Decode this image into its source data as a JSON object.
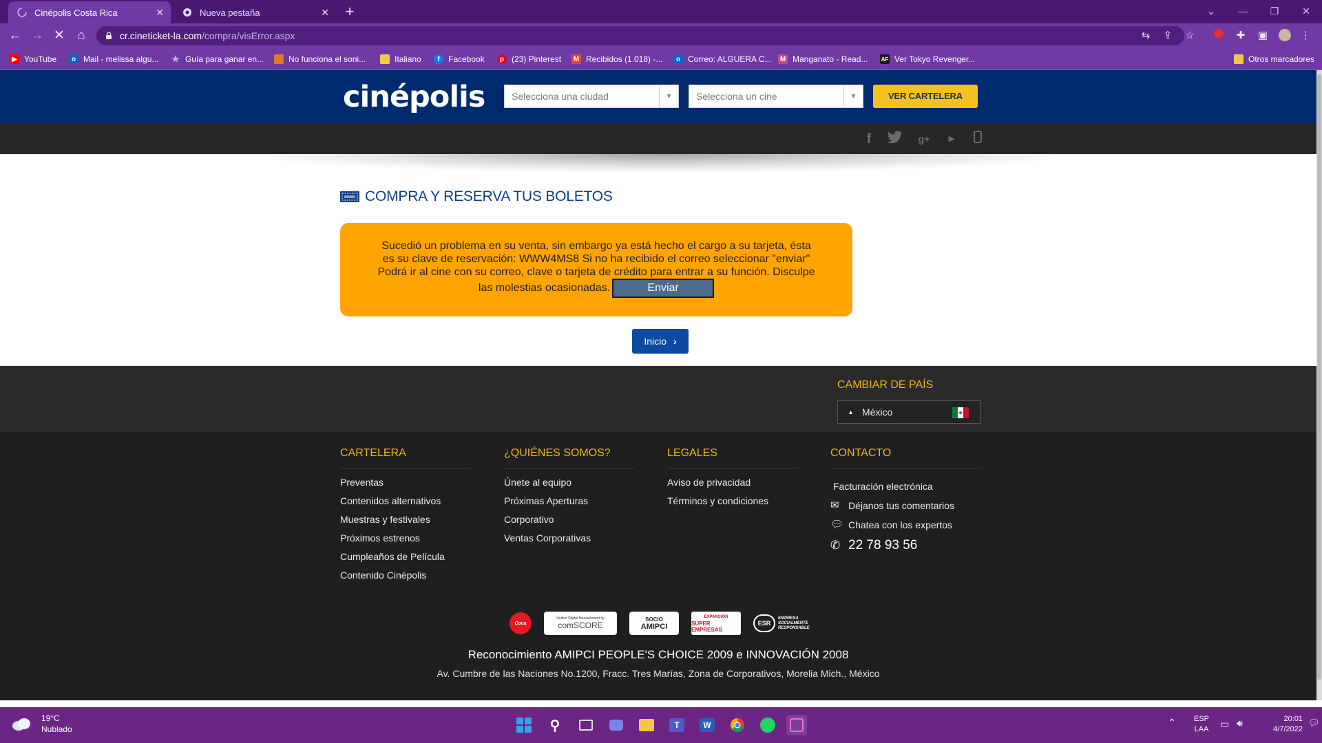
{
  "browser": {
    "tabs": [
      {
        "title": "Cinépolis Costa Rica",
        "active": true
      },
      {
        "title": "Nueva pestaña",
        "active": false
      }
    ],
    "url_host": "cr.cineticket-la.com",
    "url_path": "/compra/visError.aspx",
    "bookmarks": [
      {
        "label": "YouTube",
        "icon": "youtube-icon",
        "color": "#ff0000"
      },
      {
        "label": "Mail - melissa algu...",
        "icon": "outlook-icon",
        "color": "#0a64c8"
      },
      {
        "label": "Guía para ganar en...",
        "icon": "star-icon",
        "color": "#8fa0c8"
      },
      {
        "label": "No funciona el soni...",
        "icon": "page-icon",
        "color": "#e07a2a"
      },
      {
        "label": "Italiano",
        "icon": "folder-icon",
        "color": "#f2c94c"
      },
      {
        "label": "Facebook",
        "icon": "facebook-icon",
        "color": "#1877f2"
      },
      {
        "label": "(23) Pinterest",
        "icon": "pinterest-icon",
        "color": "#e60023"
      },
      {
        "label": "Recibidos (1.018) -...",
        "icon": "gmail-icon",
        "color": "#ea4335"
      },
      {
        "label": "Correo: ALGUERA C...",
        "icon": "outlook-icon",
        "color": "#0a64c8"
      },
      {
        "label": "Manganato - Read...",
        "icon": "manga-icon",
        "color": "#c24a8a"
      },
      {
        "label": "Ver Tokyo Revenger...",
        "icon": "af-icon",
        "color": "#1a1a1a"
      }
    ],
    "other_bookmarks": "Otros marcadores"
  },
  "header": {
    "logo": "cinépolis",
    "city_placeholder": "Selecciona una ciudad",
    "cinema_placeholder": "Selecciona un cine",
    "cartelera_button": "VER CARTELERA"
  },
  "content": {
    "section_title": "COMPRA Y RESERVA TUS BOLETOS",
    "alert_message": "Sucedió un problema en su venta, sin embargo ya está hecho el cargo a su tarjeta, ésta es su clave de reservación: WWW4MS8 Si no ha recibido el correo seleccionar \"enviar\" Podrá ir al cine con su correo, clave o tarjeta de crédito para entrar a su función. Disculpe las molestias ocasionadas.",
    "enviar_button": "Enviar",
    "inicio_button": "Inicio"
  },
  "country": {
    "title": "CAMBIAR DE PAÍS",
    "selected": "México"
  },
  "footer": {
    "columns": [
      {
        "heading": "CARTELERA",
        "links": [
          "Preventas",
          "Contenidos alternativos",
          "Muestras y festivales",
          "Próximos estrenos",
          "Cumpleaños de Película",
          "Contenido Cinépolis"
        ]
      },
      {
        "heading": "¿QUIÉNES SOMOS?",
        "links": [
          "Únete al equipo",
          "Próximas Aperturas",
          "Corporativo",
          "Ventas Corporativas"
        ]
      },
      {
        "heading": "LEGALES",
        "links": [
          "Aviso de privacidad",
          "Términos y condiciones"
        ]
      }
    ],
    "contact": {
      "heading": "CONTACTO",
      "billing": "Facturación electrónica",
      "comments": "Déjanos tus comentarios",
      "chat": "Chatea con los expertos",
      "phone": "22 78 93 56"
    },
    "logos": {
      "comscore_top": "Unified Digital Measurement by",
      "comscore": "comSCORE",
      "amipci_top": "SOCIO",
      "amipci": "AMIPCI",
      "super_top": "EXPANSIÓN",
      "super": "SÚPER EMPRESAS",
      "esr": "ESR",
      "esr_text": "EMPRESA SOCIALMENTE RESPONSABLE"
    },
    "award": "Reconocimiento AMIPCI PEOPLE'S CHOICE 2009 e INNOVACIÓN 2008",
    "address": "Av. Cumbre de las Naciones No.1200, Fracc. Tres Marías, Zona de Corporativos, Morelia Mich., México"
  },
  "taskbar": {
    "temperature": "19°C",
    "condition": "Nublado",
    "language": "ESP",
    "layout": "LAA",
    "time": "20:01",
    "date": "4/7/2022"
  },
  "colors": {
    "header_blue": "#002a6e",
    "alert_orange": "#ffa400",
    "accent_yellow": "#f3b41b",
    "chrome_purple": "#6f3aa3"
  }
}
